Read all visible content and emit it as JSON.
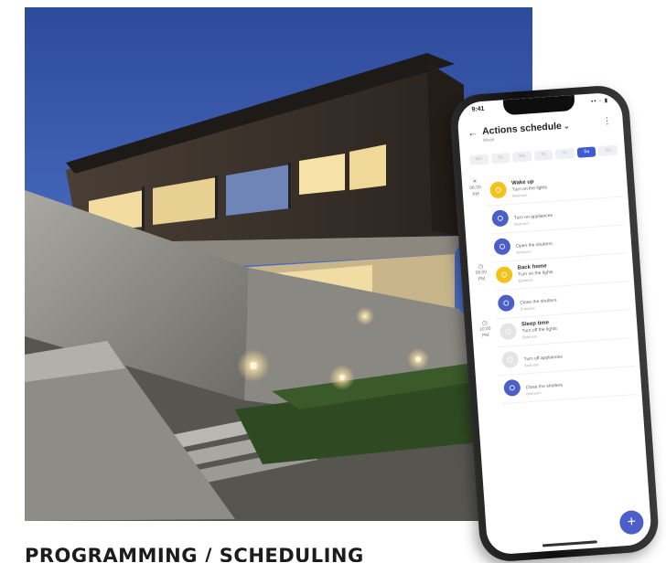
{
  "caption": "PROGRAMMING / SCHEDULING",
  "phone": {
    "status_time": "9:41",
    "status_icons": "▪▪ ◦ ▮",
    "app_title": "Actions schedule",
    "title_chevron": "⌄",
    "subtitle": "Week",
    "back_glyph": "←",
    "more_glyph": "⋮",
    "days": [
      "Mo",
      "Tu",
      "We",
      "Th",
      "Fr",
      "Sa",
      "Su"
    ],
    "selected_day": 5,
    "fab_glyph": "+",
    "groups": [
      {
        "time": "06:30 AM",
        "icon": "☀",
        "items": [
          {
            "title": "Wake up",
            "sub": "Turn on the lights",
            "note": "Bedroom",
            "color": "yellow"
          },
          {
            "title": "",
            "sub": "Turn on appliances",
            "note": "Bedroom",
            "color": "blue"
          },
          {
            "title": "",
            "sub": "Open the shutters",
            "note": "Bedroom",
            "color": "blue"
          }
        ]
      },
      {
        "time": "06:00 PM",
        "icon": "◷",
        "items": [
          {
            "title": "Back home",
            "sub": "Turn on the lights",
            "note": "Entrance",
            "color": "yellow"
          },
          {
            "title": "",
            "sub": "Close the shutters",
            "note": "Entrance",
            "color": "blue"
          }
        ]
      },
      {
        "time": "10:00 PM",
        "icon": "◷",
        "items": [
          {
            "title": "Sleep time",
            "sub": "Turn off the lights",
            "note": "Bedroom",
            "color": "grey"
          },
          {
            "title": "",
            "sub": "Turn off appliances",
            "note": "Bedroom",
            "color": "grey"
          },
          {
            "title": "",
            "sub": "Close the shutters",
            "note": "Bedroom",
            "color": "blue"
          }
        ]
      }
    ]
  },
  "colors": {
    "accent": "#4c5fc9",
    "highlight": "#f2c21b",
    "inactive": "#e4e4e4"
  }
}
